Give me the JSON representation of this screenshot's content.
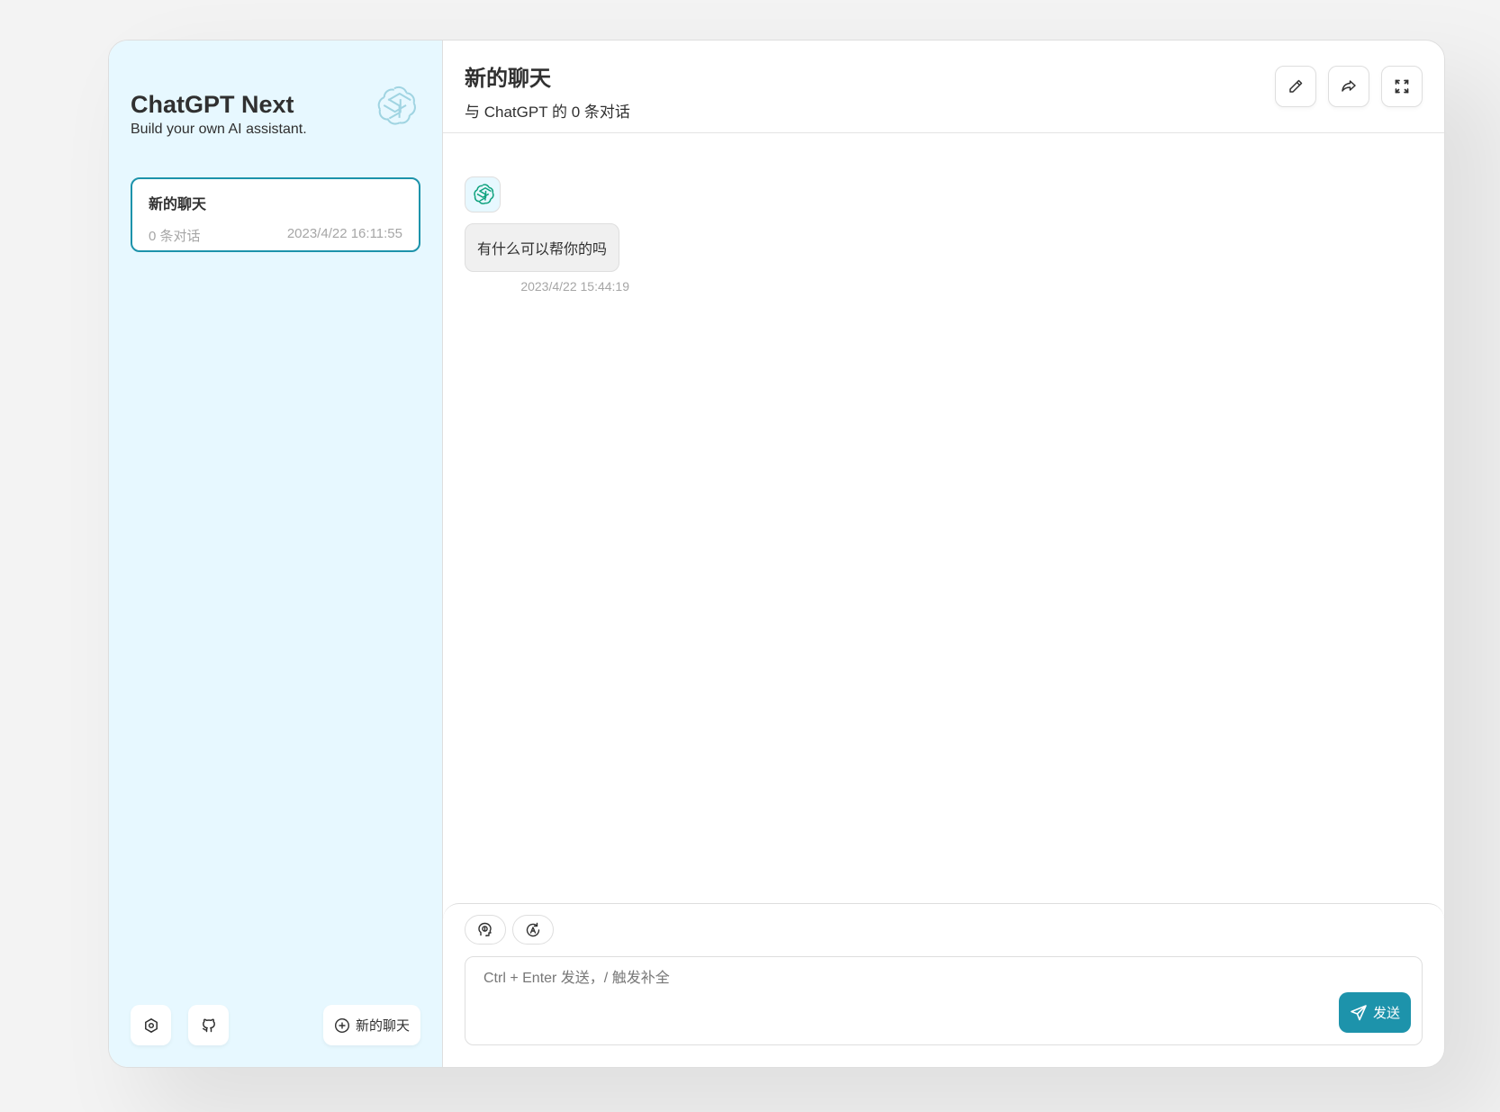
{
  "sidebar": {
    "title": "ChatGPT Next",
    "subtitle": "Build your own AI assistant.",
    "logo_icon": "openai-logo-icon",
    "chats": [
      {
        "title": "新的聊天",
        "count": "0 条对话",
        "date": "2023/4/22 16:11:55"
      }
    ],
    "footer": {
      "settings_icon": "settings-icon",
      "github_icon": "github-icon",
      "new_chat_label": "新的聊天"
    }
  },
  "main": {
    "title": "新的聊天",
    "subtitle": "与 ChatGPT 的 0 条对话",
    "header_actions": [
      "edit-icon",
      "share-icon",
      "fullscreen-icon"
    ],
    "messages": [
      {
        "role": "assistant",
        "text": "有什么可以帮你的吗",
        "time": "2023/4/22 15:44:19"
      }
    ]
  },
  "input": {
    "placeholder": "Ctrl + Enter 发送，/ 触发补全",
    "value": "",
    "send_label": "发送",
    "actions": [
      "theme-icon",
      "prompt-icon"
    ]
  },
  "colors": {
    "accent": "#1d93ab",
    "sidebar_bg": "#e7f8ff",
    "bubble_bg": "#f0f0f0"
  }
}
